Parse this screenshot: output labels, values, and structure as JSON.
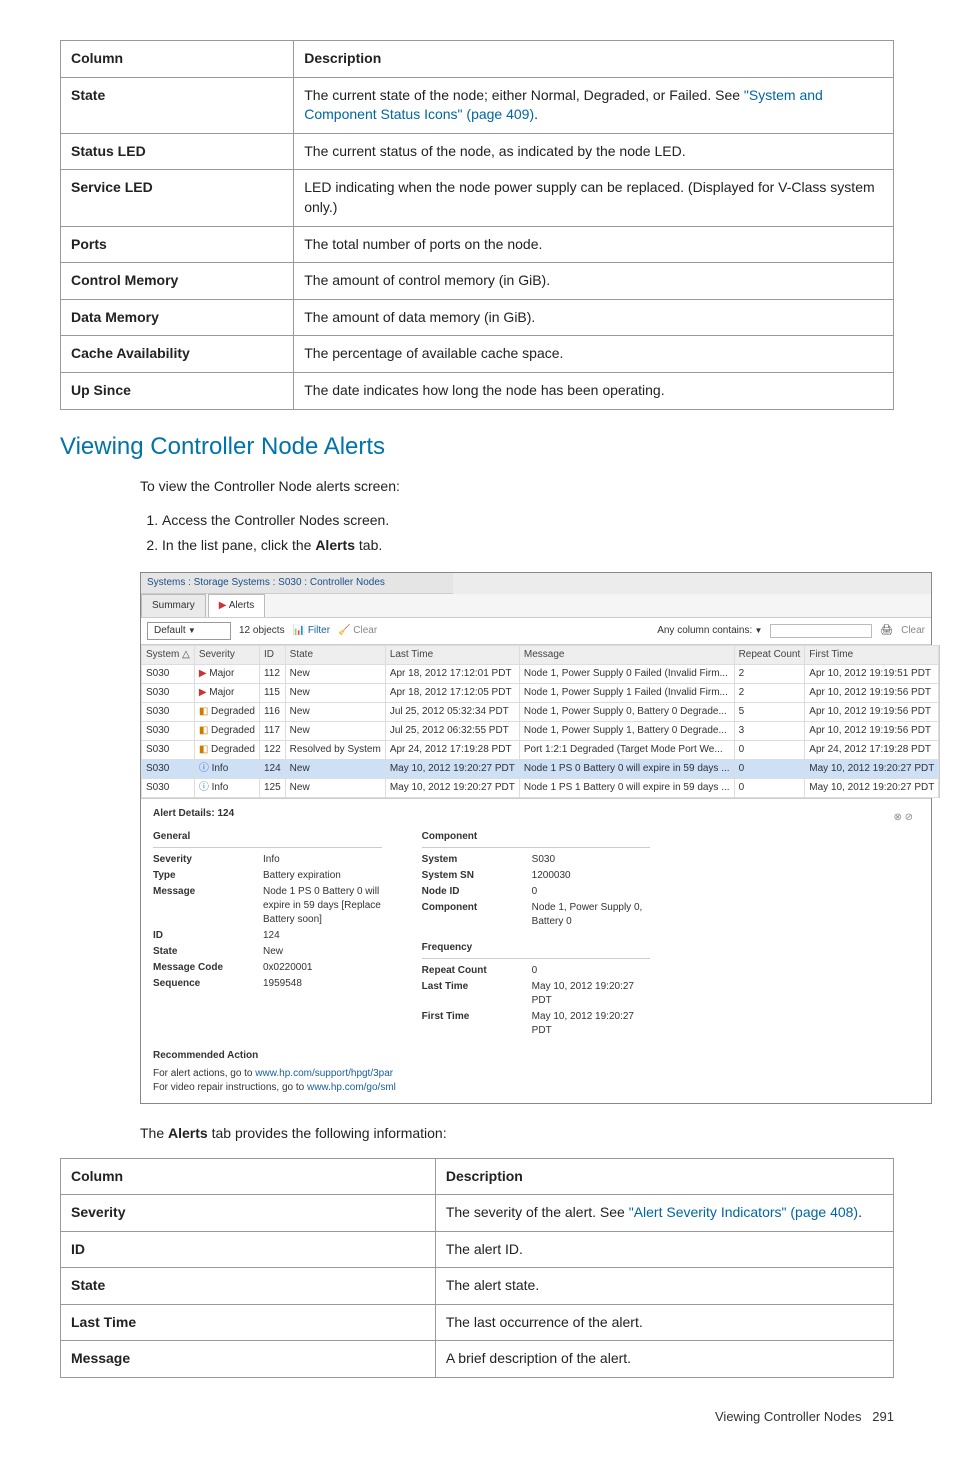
{
  "table1": {
    "headers": [
      "Column",
      "Description"
    ],
    "rows": [
      {
        "col": "State",
        "desc_pre": "The current state of the node; either Normal, Degraded, or Failed. See ",
        "link": "\"System and Component Status Icons\" (page 409)",
        "desc_post": "."
      },
      {
        "col": "Status LED",
        "desc": "The current status of the node, as indicated by the node LED."
      },
      {
        "col": "Service LED",
        "desc": "LED indicating when the node power supply can be replaced. (Displayed for V-Class system only.)"
      },
      {
        "col": "Ports",
        "desc": "The total number of ports on the node."
      },
      {
        "col": "Control Memory",
        "desc": "The amount of control memory (in GiB)."
      },
      {
        "col": "Data Memory",
        "desc": "The amount of data memory (in GiB)."
      },
      {
        "col": "Cache Availability",
        "desc": "The percentage of available cache space."
      },
      {
        "col": "Up Since",
        "desc": "The date indicates how long the node has been operating."
      }
    ]
  },
  "section_heading": "Viewing Controller Node Alerts",
  "intro": "To view the Controller Node alerts screen:",
  "steps": [
    "Access the Controller Nodes screen.",
    {
      "pre": "In the list pane, click the ",
      "bold": "Alerts",
      "post": " tab."
    }
  ],
  "screenshot": {
    "titlebar": "Systems : Storage Systems : S030 : Controller Nodes",
    "tabs": [
      "Summary",
      "Alerts"
    ],
    "active_tab": 1,
    "toolbar": {
      "select_label": "Default",
      "objects": "12 objects",
      "filter": "Filter",
      "clear": "Clear",
      "any_col": "Any column contains:"
    },
    "grid_headers": [
      "System",
      "Severity",
      "ID",
      "State",
      "Last Time",
      "Message",
      "Repeat Count",
      "First Time"
    ],
    "grid_rows": [
      {
        "sys": "S030",
        "sev": "Major",
        "sevcls": "major",
        "id": "112",
        "state": "New",
        "last": "Apr 18, 2012 17:12:01 PDT",
        "msg": "Node 1, Power Supply 0 Failed (Invalid Firm...",
        "rc": "2",
        "first": "Apr 10, 2012 19:19:51 PDT"
      },
      {
        "sys": "S030",
        "sev": "Major",
        "sevcls": "major",
        "id": "115",
        "state": "New",
        "last": "Apr 18, 2012 17:12:05 PDT",
        "msg": "Node 1, Power Supply 1 Failed (Invalid Firm...",
        "rc": "2",
        "first": "Apr 10, 2012 19:19:56 PDT"
      },
      {
        "sys": "S030",
        "sev": "Degraded",
        "sevcls": "degraded",
        "id": "116",
        "state": "New",
        "last": "Jul 25, 2012 05:32:34 PDT",
        "msg": "Node 1, Power Supply 0, Battery 0 Degrade...",
        "rc": "5",
        "first": "Apr 10, 2012 19:19:56 PDT"
      },
      {
        "sys": "S030",
        "sev": "Degraded",
        "sevcls": "degraded",
        "id": "117",
        "state": "New",
        "last": "Jul 25, 2012 06:32:55 PDT",
        "msg": "Node 1, Power Supply 1, Battery 0 Degrade...",
        "rc": "3",
        "first": "Apr 10, 2012 19:19:56 PDT"
      },
      {
        "sys": "S030",
        "sev": "Degraded",
        "sevcls": "degraded",
        "id": "122",
        "state": "Resolved by System",
        "last": "Apr 24, 2012 17:19:28 PDT",
        "msg": "Port 1:2:1 Degraded (Target Mode Port We...",
        "rc": "0",
        "first": "Apr 24, 2012 17:19:28 PDT"
      },
      {
        "sys": "S030",
        "sev": "Info",
        "sevcls": "info",
        "id": "124",
        "state": "New",
        "last": "May 10, 2012 19:20:27 PDT",
        "msg": "Node 1 PS 0 Battery 0 will expire in 59 days ...",
        "rc": "0",
        "first": "May 10, 2012 19:20:27 PDT",
        "hl": true
      },
      {
        "sys": "S030",
        "sev": "Info",
        "sevcls": "info",
        "id": "125",
        "state": "New",
        "last": "May 10, 2012 19:20:27 PDT",
        "msg": "Node 1 PS 1 Battery 0 will expire in 59 days ...",
        "rc": "0",
        "first": "May 10, 2012 19:20:27 PDT"
      }
    ],
    "details": {
      "title": "Alert Details: 124",
      "general_h": "General",
      "component_h": "Component",
      "frequency_h": "Frequency",
      "general": [
        {
          "k": "Severity",
          "v": "Info"
        },
        {
          "k": "Type",
          "v": "Battery expiration"
        },
        {
          "k": "Message",
          "v": "Node 1 PS 0 Battery 0 will expire in 59 days [Replace Battery soon]"
        },
        {
          "k": "ID",
          "v": "124"
        },
        {
          "k": "State",
          "v": "New"
        },
        {
          "k": "Message Code",
          "v": "0x0220001"
        },
        {
          "k": "Sequence",
          "v": "1959548"
        }
      ],
      "component": [
        {
          "k": "System",
          "v": "S030"
        },
        {
          "k": "System SN",
          "v": "1200030"
        },
        {
          "k": "Node ID",
          "v": "0"
        },
        {
          "k": "Component",
          "v": "Node 1, Power Supply 0, Battery 0"
        }
      ],
      "frequency": [
        {
          "k": "Repeat Count",
          "v": "0"
        },
        {
          "k": "Last Time",
          "v": "May 10, 2012 19:20:27 PDT"
        },
        {
          "k": "First Time",
          "v": "May 10, 2012 19:20:27 PDT"
        }
      ],
      "rec_h": "Recommended Action",
      "rec_lines": [
        {
          "pre": "For alert actions, go to ",
          "link": "www.hp.com/support/hpgt/3par"
        },
        {
          "pre": "For video repair instructions, go to ",
          "link": "www.hp.com/go/sml"
        }
      ]
    }
  },
  "alerts_intro_pre": "The ",
  "alerts_intro_bold": "Alerts",
  "alerts_intro_post": " tab provides the following information:",
  "table2": {
    "headers": [
      "Column",
      "Description"
    ],
    "rows": [
      {
        "col": "Severity",
        "desc_pre": "The severity of the alert. See ",
        "link": "\"Alert Severity Indicators\" (page 408)",
        "desc_post": "."
      },
      {
        "col": "ID",
        "desc": "The alert ID."
      },
      {
        "col": "State",
        "desc": "The alert state."
      },
      {
        "col": "Last Time",
        "desc": "The last occurrence of the alert."
      },
      {
        "col": "Message",
        "desc": "A brief description of the alert."
      }
    ]
  },
  "footer": {
    "label": "Viewing Controller Nodes",
    "page": "291"
  }
}
